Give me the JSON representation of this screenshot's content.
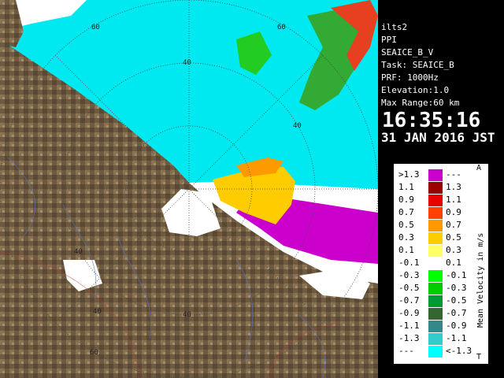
{
  "radar_info": {
    "site": "ilts2",
    "scan_type": "PPI",
    "product": "SEAICE_B_V",
    "task": "Task: SEAICE_B",
    "prf": "PRF: 1000Hz",
    "elevation": "Elevation:1.0",
    "max_range": "Max Range:60 km",
    "time": "16:35:16",
    "date": "31 JAN 2016 JST"
  },
  "range_ring_labels": [
    "60",
    "40",
    "60",
    "40",
    "40",
    "40",
    "40",
    "60"
  ],
  "legend": {
    "title": "Mean Velocity in m/s",
    "top_marker": "A",
    "bottom_marker": "T",
    "rows": [
      {
        "lo": ">1.3",
        "hi": "---",
        "color": "#cc00cc"
      },
      {
        "lo": "1.1",
        "hi": "1.3",
        "color": "#990000"
      },
      {
        "lo": "0.9",
        "hi": "1.1",
        "color": "#e60000"
      },
      {
        "lo": "0.7",
        "hi": "0.9",
        "color": "#ff4000"
      },
      {
        "lo": "0.5",
        "hi": "0.7",
        "color": "#ff9900"
      },
      {
        "lo": "0.3",
        "hi": "0.5",
        "color": "#ffcc00"
      },
      {
        "lo": "0.1",
        "hi": "0.3",
        "color": "#ffff66"
      },
      {
        "lo": "-0.1",
        "hi": "0.1",
        "color": "#ffffff"
      },
      {
        "lo": "-0.3",
        "hi": "-0.1",
        "color": "#00ff00"
      },
      {
        "lo": "-0.5",
        "hi": "-0.3",
        "color": "#00cc00"
      },
      {
        "lo": "-0.7",
        "hi": "-0.5",
        "color": "#009933"
      },
      {
        "lo": "-0.9",
        "hi": "-0.7",
        "color": "#336633"
      },
      {
        "lo": "-1.1",
        "hi": "-0.9",
        "color": "#338888"
      },
      {
        "lo": "-1.3",
        "hi": "-1.1",
        "color": "#33cccc"
      },
      {
        "lo": "---",
        "hi": "<-1.3",
        "color": "#00ffff"
      }
    ]
  },
  "colors": {
    "land": "#6e5a40",
    "sea_background": "#00e8f0",
    "range_ring": "#444444"
  }
}
